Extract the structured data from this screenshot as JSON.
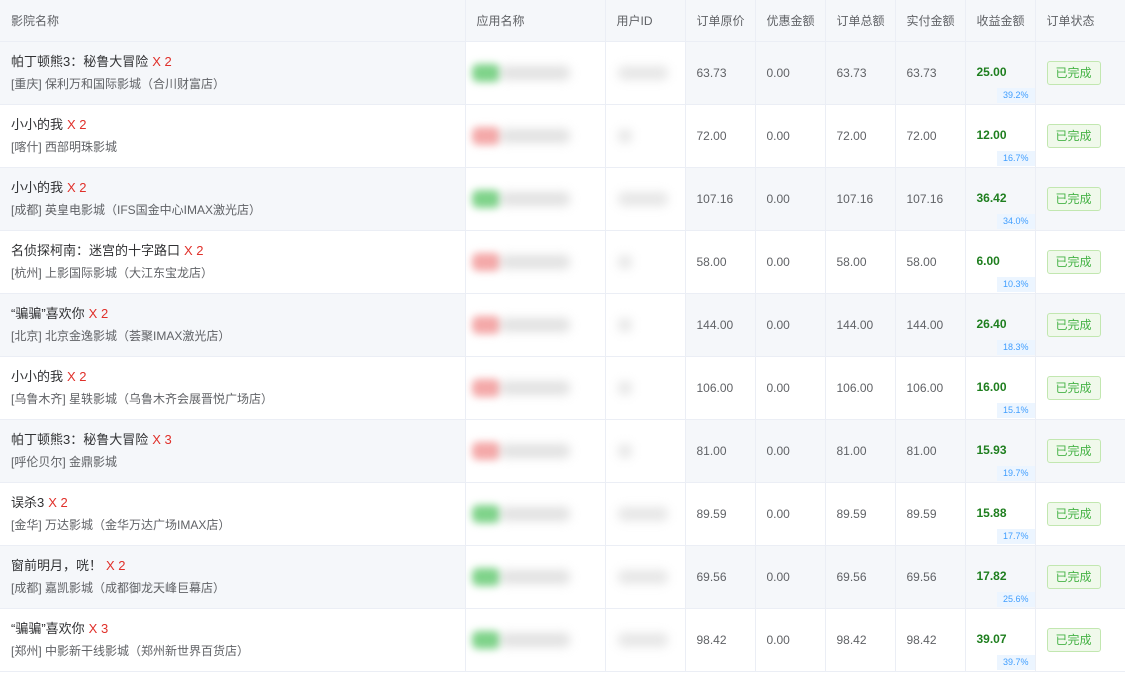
{
  "headers": [
    "影院名称",
    "应用名称",
    "用户ID",
    "订单原价",
    "优惠金额",
    "订单总额",
    "实付金额",
    "收益金额",
    "订单状态"
  ],
  "colors": {
    "quantity": "#e0302a",
    "profit": "#1e7e1e",
    "rate": "#409eff",
    "status": "#47b347",
    "app_green": "#7fd38a",
    "app_pink": "#f4a9a9"
  },
  "rows": [
    {
      "movie": "帕丁顿熊3：秘鲁大冒险",
      "qty": "X 2",
      "cinema": "[重庆] 保利万和国际影城（合川财富店）",
      "app_color": "green",
      "user_width": 50,
      "original": "63.73",
      "discount": "0.00",
      "total": "63.73",
      "paid": "63.73",
      "profit": "25.00",
      "rate": "39.2%",
      "status": "已完成"
    },
    {
      "movie": "小小的我",
      "qty": "X 2",
      "cinema": "[喀什] 西部明珠影城",
      "app_color": "pink",
      "user_width": 14,
      "original": "72.00",
      "discount": "0.00",
      "total": "72.00",
      "paid": "72.00",
      "profit": "12.00",
      "rate": "16.7%",
      "status": "已完成"
    },
    {
      "movie": "小小的我",
      "qty": "X 2",
      "cinema": "[成都] 英皇电影城（IFS国金中心IMAX激光店）",
      "app_color": "green",
      "user_width": 50,
      "original": "107.16",
      "discount": "0.00",
      "total": "107.16",
      "paid": "107.16",
      "profit": "36.42",
      "rate": "34.0%",
      "status": "已完成"
    },
    {
      "movie": "名侦探柯南：迷宫的十字路口",
      "qty": "X 2",
      "cinema": "[杭州] 上影国际影城（大江东宝龙店）",
      "app_color": "pink",
      "user_width": 14,
      "original": "58.00",
      "discount": "0.00",
      "total": "58.00",
      "paid": "58.00",
      "profit": "6.00",
      "rate": "10.3%",
      "status": "已完成"
    },
    {
      "movie": "“骗骗”喜欢你",
      "qty": "X 2",
      "cinema": "[北京] 北京金逸影城（荟聚IMAX激光店）",
      "app_color": "pink",
      "user_width": 14,
      "original": "144.00",
      "discount": "0.00",
      "total": "144.00",
      "paid": "144.00",
      "profit": "26.40",
      "rate": "18.3%",
      "status": "已完成"
    },
    {
      "movie": "小小的我",
      "qty": "X 2",
      "cinema": "[乌鲁木齐] 星轶影城（乌鲁木齐会展晋悦广场店）",
      "app_color": "pink",
      "user_width": 14,
      "original": "106.00",
      "discount": "0.00",
      "total": "106.00",
      "paid": "106.00",
      "profit": "16.00",
      "rate": "15.1%",
      "status": "已完成"
    },
    {
      "movie": "帕丁顿熊3：秘鲁大冒险",
      "qty": "X 3",
      "cinema": "[呼伦贝尔] 金鼎影城",
      "app_color": "pink",
      "user_width": 14,
      "original": "81.00",
      "discount": "0.00",
      "total": "81.00",
      "paid": "81.00",
      "profit": "15.93",
      "rate": "19.7%",
      "status": "已完成"
    },
    {
      "movie": "误杀3",
      "qty": "X 2",
      "cinema": "[金华] 万达影城（金华万达广场IMAX店）",
      "app_color": "green",
      "user_width": 50,
      "original": "89.59",
      "discount": "0.00",
      "total": "89.59",
      "paid": "89.59",
      "profit": "15.88",
      "rate": "17.7%",
      "status": "已完成"
    },
    {
      "movie": "窗前明月，咣！",
      "qty": "X 2",
      "cinema": "[成都] 嘉凯影城（成都御龙天峰巨幕店）",
      "app_color": "green",
      "user_width": 50,
      "original": "69.56",
      "discount": "0.00",
      "total": "69.56",
      "paid": "69.56",
      "profit": "17.82",
      "rate": "25.6%",
      "status": "已完成"
    },
    {
      "movie": "“骗骗”喜欢你",
      "qty": "X 3",
      "cinema": "[郑州] 中影新干线影城（郑州新世界百货店）",
      "app_color": "green",
      "user_width": 50,
      "original": "98.42",
      "discount": "0.00",
      "total": "98.42",
      "paid": "98.42",
      "profit": "39.07",
      "rate": "39.7%",
      "status": "已完成"
    }
  ]
}
